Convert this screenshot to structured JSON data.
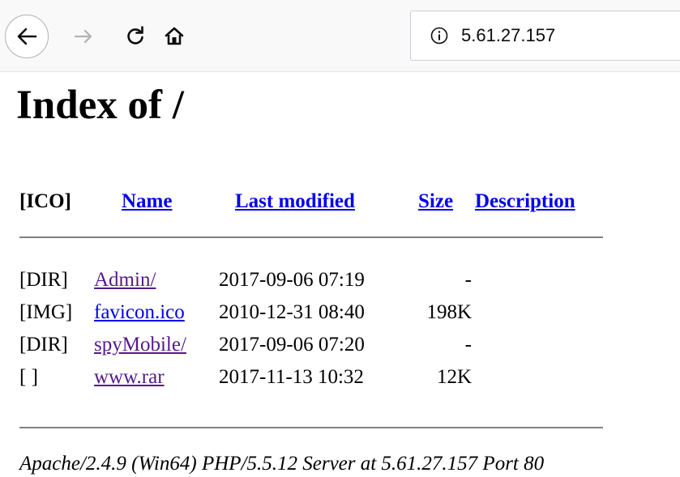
{
  "browser": {
    "url": "5.61.27.157",
    "back_icon": "arrow-left-icon",
    "forward_icon": "arrow-right-icon",
    "reload_icon": "reload-icon",
    "home_icon": "home-icon",
    "info_icon": "info-circle-icon"
  },
  "page": {
    "title": "Index of /",
    "columns": {
      "icon": "[ICO]",
      "name": "Name",
      "last_modified": "Last modified",
      "size": "Size",
      "description": "Description"
    },
    "rows": [
      {
        "type": "[DIR]",
        "name": "Admin/",
        "modified": "2017-09-06 07:19",
        "size": "-",
        "visited": true
      },
      {
        "type": "[IMG]",
        "name": "favicon.ico",
        "modified": "2010-12-31 08:40",
        "size": "198K",
        "visited": false
      },
      {
        "type": "[DIR]",
        "name": "spyMobile/",
        "modified": "2017-09-06 07:20",
        "size": "-",
        "visited": true
      },
      {
        "type": "[ ]",
        "name": "www.rar",
        "modified": "2017-11-13 10:32",
        "size": "12K",
        "visited": true
      }
    ],
    "signature": "Apache/2.4.9 (Win64) PHP/5.5.12 Server at 5.61.27.157 Port 80"
  },
  "colors": {
    "link": "#0000ee",
    "visited_link": "#551a8b",
    "rule": "#808080",
    "toolbar": "#f9f9fa"
  }
}
